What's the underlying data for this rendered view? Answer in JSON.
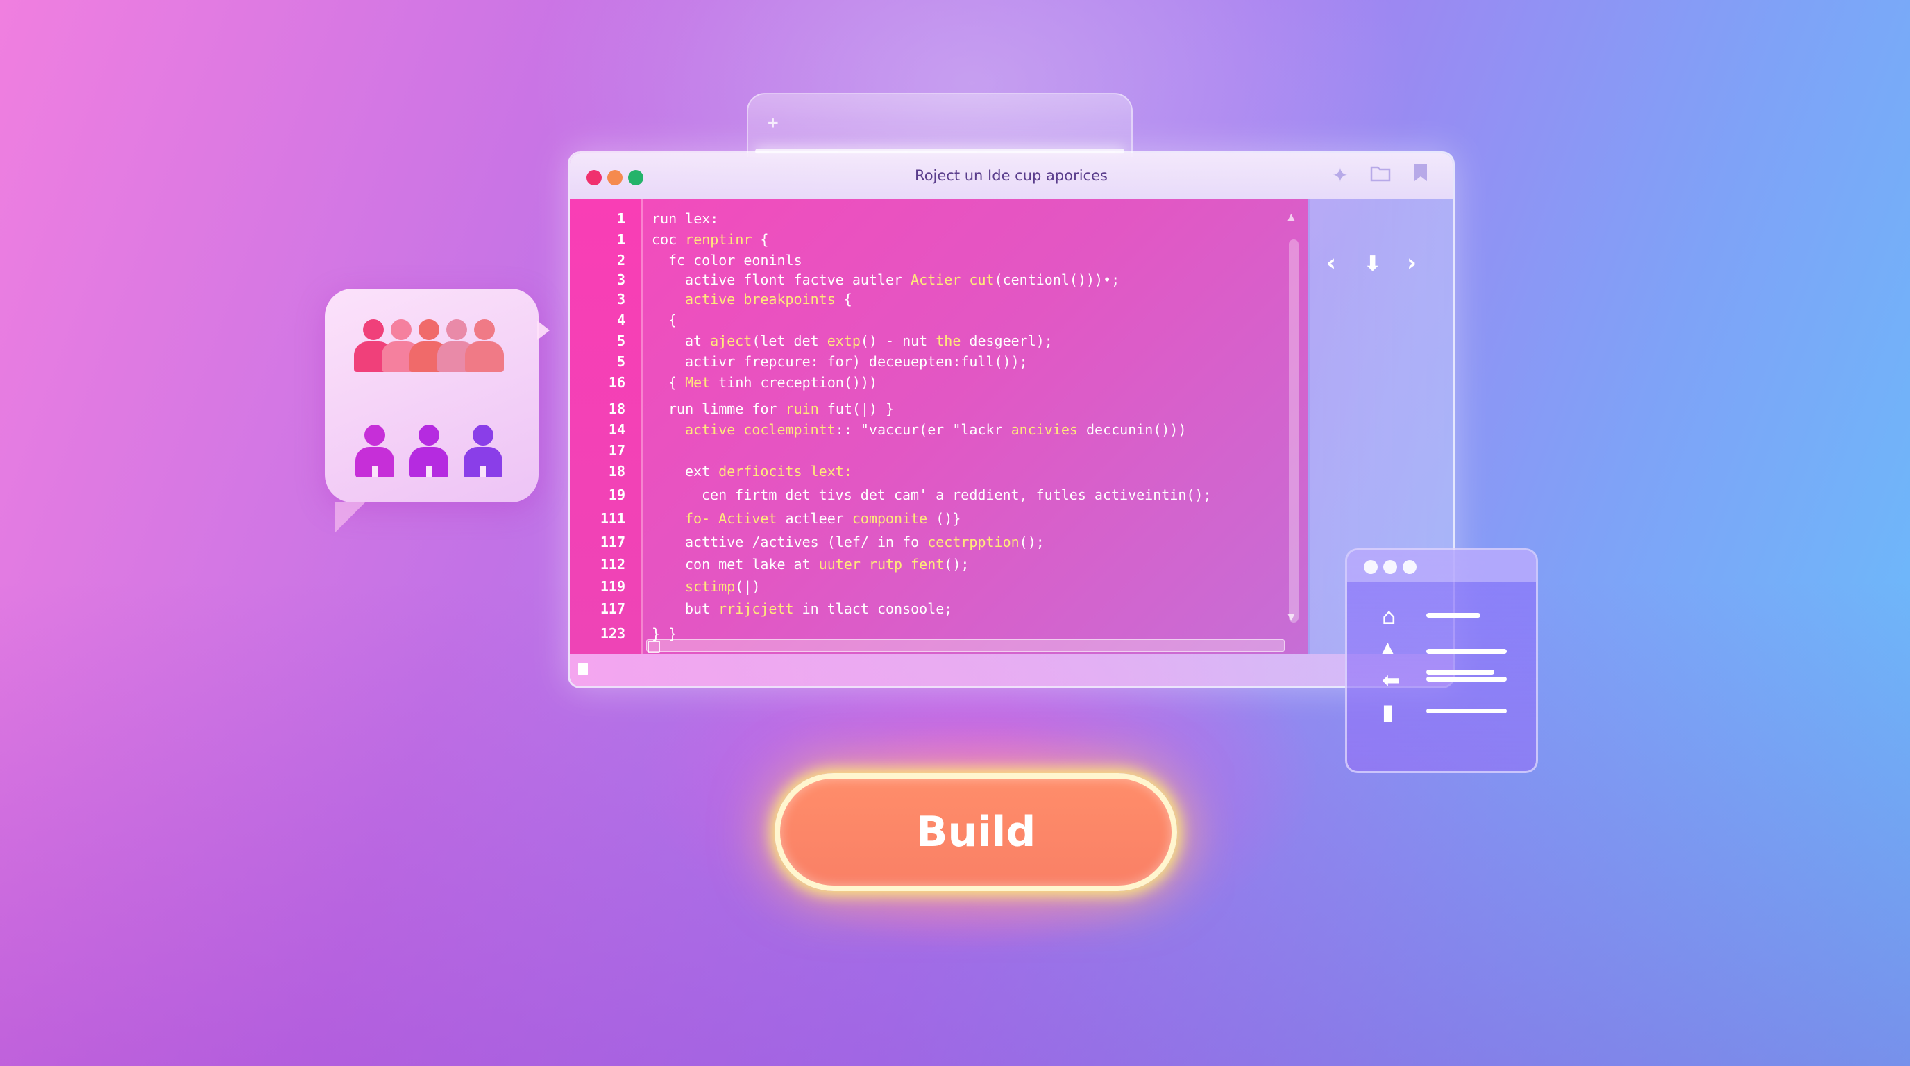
{
  "window": {
    "title": "Roject un Ide cup aporices"
  },
  "toolbar_icons": [
    "sparkle-icon",
    "folder-icon",
    "bookmark-icon"
  ],
  "editor": {
    "lines": [
      {
        "num": "1",
        "indent": 0,
        "segs": [
          {
            "t": "run lex:"
          }
        ]
      },
      {
        "num": "1",
        "indent": 0,
        "segs": [
          {
            "t": "coc "
          },
          {
            "t": "renptinr",
            "k": 1
          },
          {
            "t": " {"
          }
        ]
      },
      {
        "num": "2",
        "indent": 1,
        "segs": [
          {
            "t": "fc color eoninls"
          }
        ]
      },
      {
        "num": "3",
        "indent": 2,
        "segs": [
          {
            "t": "active flont factve autler "
          },
          {
            "t": "Actier cut",
            "k": 1
          },
          {
            "t": "(centionl()))•;"
          }
        ]
      },
      {
        "num": "3",
        "indent": 2,
        "segs": [
          {
            "t": "active breakpoints",
            "k": 1
          },
          {
            "t": " {"
          }
        ]
      },
      {
        "num": "4",
        "indent": 1,
        "segs": [
          {
            "t": "{"
          }
        ]
      },
      {
        "num": "5",
        "indent": 2,
        "segs": [
          {
            "t": "at "
          },
          {
            "t": "aject",
            "k": 1
          },
          {
            "t": "(let det "
          },
          {
            "t": "extp",
            "k": 1
          },
          {
            "t": "() - nut "
          },
          {
            "t": "the",
            "k": 1
          },
          {
            "t": " desgeerl);"
          }
        ]
      },
      {
        "num": "5",
        "indent": 2,
        "segs": [
          {
            "t": "activr frepcure: for) deceuepten:full());"
          }
        ]
      },
      {
        "num": "16",
        "indent": 1,
        "segs": [
          {
            "t": "{ "
          },
          {
            "t": "Met",
            "k": 1
          },
          {
            "t": " tinh creception()))"
          }
        ]
      },
      {
        "num": "18",
        "indent": 1,
        "segs": [
          {
            "t": "run limme for "
          },
          {
            "t": "ruin",
            "k": 1
          },
          {
            "t": " fut(|) }"
          }
        ]
      },
      {
        "num": "14",
        "indent": 2,
        "segs": [
          {
            "t": "active coclempintt",
            "k": 1
          },
          {
            "t": ":: \"vaccur(er \"lackr "
          },
          {
            "t": "ancivies",
            "k": 1
          },
          {
            "t": " deccunin()))"
          }
        ]
      },
      {
        "num": "17",
        "indent": 0,
        "segs": [
          {
            "t": ""
          }
        ]
      },
      {
        "num": "18",
        "indent": 2,
        "segs": [
          {
            "t": "ext "
          },
          {
            "t": "derfiocits lext:",
            "k": 1
          }
        ]
      },
      {
        "num": "19",
        "indent": 3,
        "segs": [
          {
            "t": "cen firtm det tivs det cam' a reddient, futles activeintin();"
          }
        ]
      },
      {
        "num": "111",
        "indent": 2,
        "segs": [
          {
            "t": "fo- Activet",
            "k": 1
          },
          {
            "t": " actleer "
          },
          {
            "t": "componite",
            "k": 1
          },
          {
            "t": " ()}"
          }
        ]
      },
      {
        "num": "117",
        "indent": 2,
        "segs": [
          {
            "t": "acttive /actives (lef/ in fo "
          },
          {
            "t": "cectrpption",
            "k": 1
          },
          {
            "t": "();"
          }
        ]
      },
      {
        "num": "112",
        "indent": 2,
        "segs": [
          {
            "t": "con met lake at "
          },
          {
            "t": "uuter rutp fent",
            "k": 1
          },
          {
            "t": "();"
          }
        ]
      },
      {
        "num": "119",
        "indent": 2,
        "segs": [
          {
            "t": "sctimp",
            "k": 1
          },
          {
            "t": "(|)"
          }
        ]
      },
      {
        "num": "117",
        "indent": 2,
        "segs": [
          {
            "t": "but "
          },
          {
            "t": "rrijcjett",
            "k": 1
          },
          {
            "t": " in tlact consoole;"
          }
        ]
      },
      {
        "num": "123",
        "indent": 0,
        "segs": [
          {
            "t": "} }"
          }
        ]
      }
    ]
  },
  "nav_arrows": [
    "chevron-left-icon",
    "download-arrow-icon",
    "chevron-right-icon"
  ],
  "people_panel": {
    "top_row_colors": [
      "#f0407a",
      "#f5809e",
      "#f06a6a",
      "#e98aa8",
      "#f07a86"
    ],
    "bottom_row_colors": [
      "#c62fd8",
      "#b52be0",
      "#8a3ee8"
    ]
  },
  "mini_window": {
    "rows": [
      {
        "icon": "home-icon",
        "glyph": "⌂"
      },
      {
        "icon": "home-small-icon",
        "glyph": "▲"
      },
      {
        "icon": "arrow-left-icon",
        "glyph": "⬅"
      },
      {
        "icon": "trash-icon",
        "glyph": "▮"
      }
    ]
  },
  "build_button": {
    "label": "Build"
  },
  "colors": {
    "accent_yellow": "#ffe97a",
    "editor_pink": "#f24cbc",
    "button_orange": "#ff8d6a"
  }
}
